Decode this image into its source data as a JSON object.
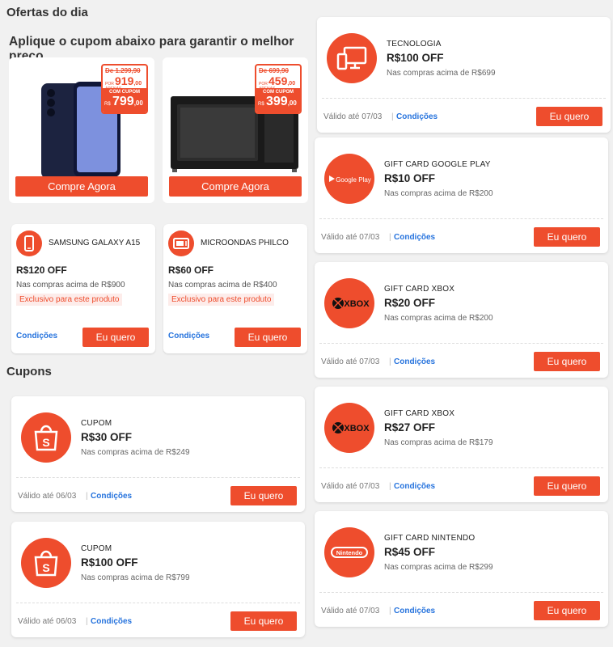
{
  "colors": {
    "accent": "#ee4d2d",
    "link": "#2673dd",
    "bg": "#f1f1f1"
  },
  "header": {
    "title": "Ofertas do dia",
    "subtitle": "Aplique o cupom abaixo para garantir o melhor preço"
  },
  "products": [
    {
      "icon": "smartphone-image",
      "old_price": "De 1.299,90",
      "por_label": "POR APENAS R$",
      "por_price": "919",
      "por_cents": ",00",
      "com_cupom_label": "COM CUPOM",
      "rs": "R$",
      "cupom_price": "799",
      "cupom_cents": ",00",
      "buy_label": "Compre Agora"
    },
    {
      "icon": "microwave-image",
      "old_price": "De 699,90",
      "por_label": "POR APENAS R$",
      "por_price": "459",
      "por_cents": ",00",
      "com_cupom_label": "COM CUPOM",
      "rs": "R$",
      "cupom_price": "399",
      "cupom_cents": ",00",
      "buy_label": "Compre Agora"
    }
  ],
  "product_coupons": [
    {
      "icon": "smartphone-icon",
      "name": "SAMSUNG GALAXY A15",
      "amount": "R$120 OFF",
      "min": "Nas compras acima de R$900",
      "exclusive": "Exclusivo para este produto",
      "conditions": "Condições",
      "button": "Eu quero"
    },
    {
      "icon": "microwave-icon",
      "name": "MICROONDAS PHILCO",
      "amount": "R$60 OFF",
      "min": "Nas compras acima de R$400",
      "exclusive": "Exclusivo para este produto",
      "conditions": "Condições",
      "button": "Eu quero"
    }
  ],
  "cupons_title": "Cupons",
  "left_coupons": [
    {
      "icon": "shopee-bag-icon",
      "category": "CUPOM",
      "amount": "R$30 OFF",
      "min": "Nas compras acima de R$249",
      "valid": "Válido até 06/03",
      "sep": "|",
      "conditions": "Condições",
      "button": "Eu quero"
    },
    {
      "icon": "shopee-bag-icon",
      "category": "CUPOM",
      "amount": "R$100 OFF",
      "min": "Nas compras acima de R$799",
      "valid": "Válido até 06/03",
      "sep": "|",
      "conditions": "Condições",
      "button": "Eu quero"
    }
  ],
  "right_coupons": [
    {
      "icon": "computer-icon",
      "category": "TECNOLOGIA",
      "amount": "R$100 OFF",
      "min": "Nas compras acima de R$699",
      "valid": "Válido até 07/03",
      "sep": "|",
      "conditions": "Condições",
      "button": "Eu quero",
      "logo_text": ""
    },
    {
      "icon": "google-play-icon",
      "category": "GIFT CARD GOOGLE PLAY",
      "amount": "R$10 OFF",
      "min": "Nas compras acima de R$200",
      "valid": "Válido até 07/03",
      "sep": "|",
      "conditions": "Condições",
      "button": "Eu quero",
      "logo_text": "Google Play"
    },
    {
      "icon": "xbox-icon",
      "category": "GIFT CARD XBOX",
      "amount": "R$20 OFF",
      "min": "Nas compras acima de R$200",
      "valid": "Válido até 07/03",
      "sep": "|",
      "conditions": "Condições",
      "button": "Eu quero",
      "logo_text": "XBOX"
    },
    {
      "icon": "xbox-icon",
      "category": "GIFT CARD XBOX",
      "amount": "R$27 OFF",
      "min": "Nas compras acima de R$179",
      "valid": "Válido até 07/03",
      "sep": "|",
      "conditions": "Condições",
      "button": "Eu quero",
      "logo_text": "XBOX"
    },
    {
      "icon": "nintendo-icon",
      "category": "GIFT CARD NINTENDO",
      "amount": "R$45 OFF",
      "min": "Nas compras acima de R$299",
      "valid": "Válido até 07/03",
      "sep": "|",
      "conditions": "Condições",
      "button": "Eu quero",
      "logo_text": "Nintendo"
    }
  ]
}
